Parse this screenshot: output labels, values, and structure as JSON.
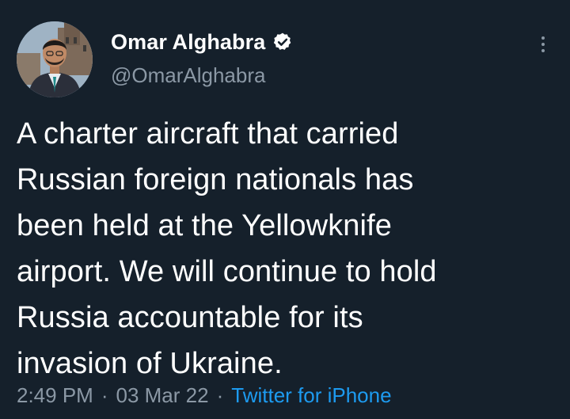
{
  "author": {
    "display_name": "Omar Alghabra",
    "handle": "@OmarAlghabra",
    "verified": true
  },
  "tweet": {
    "text": "A charter aircraft that carried\nRussian foreign nationals has\nbeen held at the Yellowknife\nairport. We will continue to hold\nRussia accountable for its\ninvasion of Ukraine.",
    "time": "2:49 PM",
    "separator": "·",
    "date": "03 Mar 22",
    "source": "Twitter for iPhone"
  },
  "colors": {
    "background": "#15202b",
    "text_primary": "#ffffff",
    "text_secondary": "#8b98a5",
    "accent": "#1d9bf0"
  },
  "icons": {
    "verified": "verified-badge-icon",
    "more": "more-options-icon"
  }
}
